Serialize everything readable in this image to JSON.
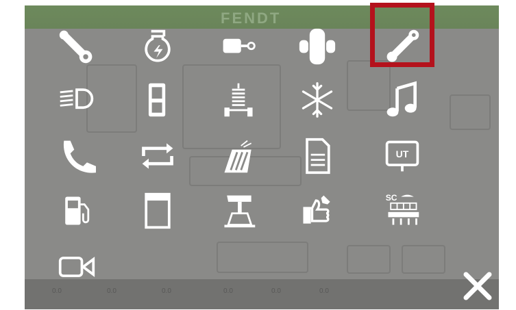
{
  "header": {
    "brand": "FENDT"
  },
  "background": {
    "status_values": [
      "0.0",
      "0.0",
      "0.0",
      "0.0",
      "0.0",
      "0.0"
    ]
  },
  "menu": {
    "items": [
      {
        "icon": "wrench-icon",
        "interactable": true
      },
      {
        "icon": "engine-icon",
        "interactable": true
      },
      {
        "icon": "hitch-icon",
        "interactable": true
      },
      {
        "icon": "axle-icon",
        "interactable": true
      },
      {
        "icon": "wrench-highlighted-icon",
        "interactable": true
      },
      {
        "icon": "headlight-icon",
        "interactable": true
      },
      {
        "icon": "door-icon",
        "interactable": true
      },
      {
        "icon": "suspension-icon",
        "interactable": true
      },
      {
        "icon": "snowflake-icon",
        "interactable": true
      },
      {
        "icon": "music-note-icon",
        "interactable": true
      },
      {
        "icon": "phone-icon",
        "interactable": true
      },
      {
        "icon": "repeat-arrows-icon",
        "interactable": true
      },
      {
        "icon": "field-spray-icon",
        "interactable": true
      },
      {
        "icon": "document-icon",
        "interactable": true
      },
      {
        "icon": "ut-terminal-icon",
        "interactable": true
      },
      {
        "icon": "fuel-pump-icon",
        "interactable": true
      },
      {
        "icon": "window-icon",
        "interactable": true
      },
      {
        "icon": "implement-icon",
        "interactable": true
      },
      {
        "icon": "hand-wrench-icon",
        "interactable": true
      },
      {
        "icon": "section-control-icon",
        "interactable": true
      },
      {
        "icon": "camera-icon",
        "interactable": true
      }
    ],
    "ut_text": "UT",
    "sc_text": "SC",
    "highlight_color": "#b4121c",
    "icon_color": "#ffffff"
  },
  "close_button": {
    "icon": "close-icon"
  }
}
